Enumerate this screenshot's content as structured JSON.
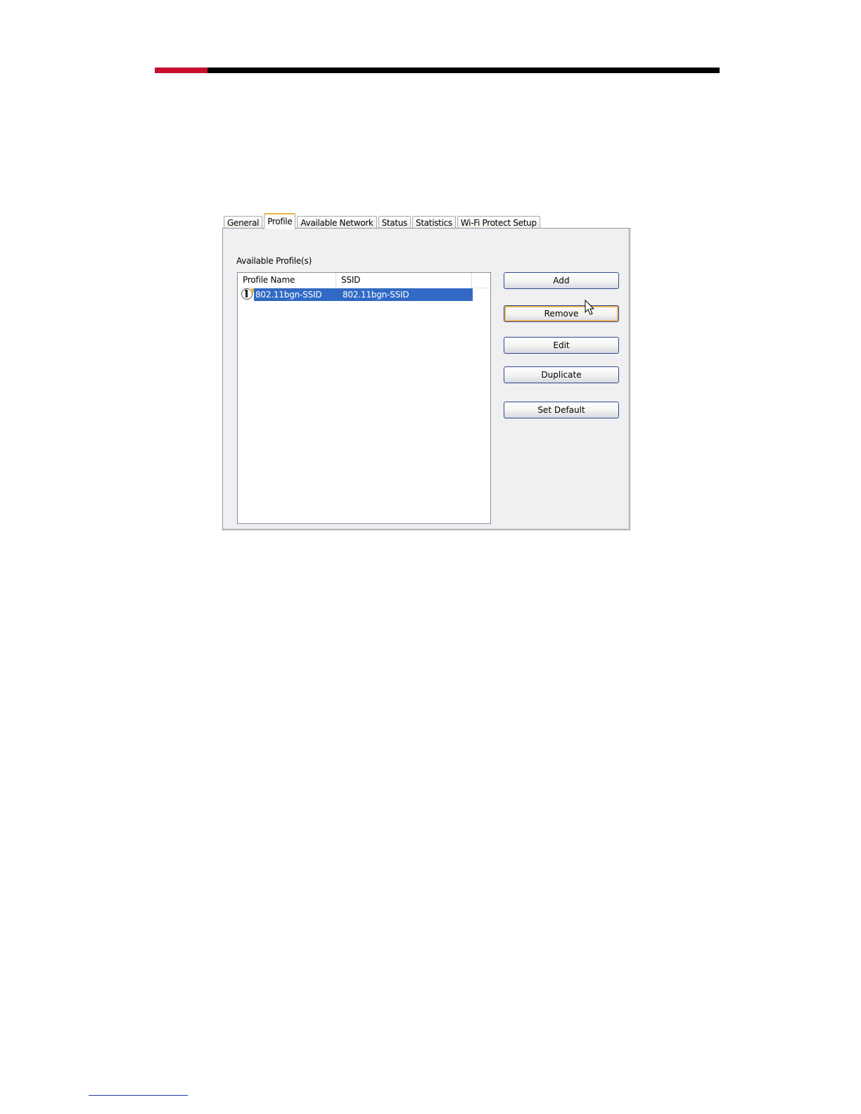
{
  "tabs": [
    {
      "label": "General"
    },
    {
      "label": "Profile"
    },
    {
      "label": "Available Network"
    },
    {
      "label": "Status"
    },
    {
      "label": "Statistics"
    },
    {
      "label": "Wi-Fi Protect Setup"
    }
  ],
  "active_tab": "Profile",
  "profile_panel": {
    "group_label": "Available Profile(s)",
    "columns": [
      "Profile Name",
      "SSID"
    ],
    "rows": [
      {
        "profile_name": "802.11bgn-SSID",
        "ssid": "802.11bgn-SSID",
        "selected": true,
        "icon": "profile-info-icon"
      }
    ]
  },
  "buttons": {
    "add": "Add",
    "remove": "Remove",
    "edit": "Edit",
    "duplicate": "Duplicate",
    "set_default": "Set Default"
  },
  "colors": {
    "accent_red": "#c8102e",
    "selection": "#316ac5",
    "active_tab_highlight": "#f4b342"
  }
}
